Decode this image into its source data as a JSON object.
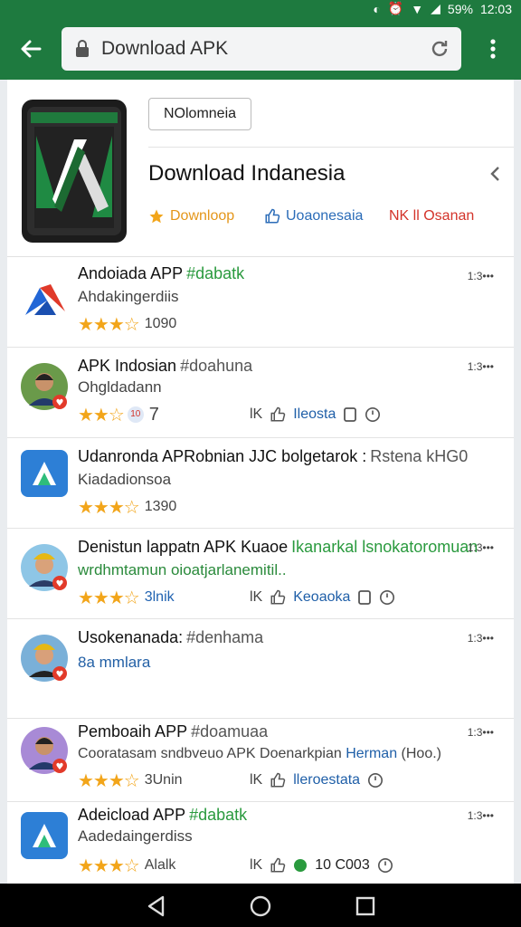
{
  "status": {
    "battery": "59%",
    "time": "12:03"
  },
  "url_bar": {
    "text": "Download APK"
  },
  "header": {
    "region_chip": "NOlomneia",
    "title": "Download Indanesia",
    "actions": {
      "download": "Downloop",
      "like": "Uoaonesaia",
      "report": "NK ll Osanan"
    }
  },
  "items": [
    {
      "title": "Andoiada APP",
      "tag": "#dabatk",
      "subtitle": "Ahdakingerdiis",
      "stars": "★★★☆",
      "count": "1090",
      "time": "1:3•••"
    },
    {
      "title": "APK Indosian",
      "tag": "#doahuna",
      "subtitle": "Ohgldadann",
      "stars": "★★☆",
      "count": "7",
      "time": "1:3•••",
      "mid_left": "lK",
      "mid_link": "Ileosta"
    },
    {
      "title": "Udanronda APRobnian ЈЈС bolgetarok :",
      "tag": "Rstena kHG0",
      "subtitle": "Kiadadionsoa",
      "stars": "★★★☆",
      "count": "1390",
      "time": ""
    },
    {
      "title": "Denistun lappatn APK Kuaoe",
      "tag": "Ikanarkal lsnokatoromuan",
      "subtitle": "wrdhmtamun oioatjarlanemitil..",
      "stars": "★★★☆",
      "count": "3lnik",
      "time": "1:3•••",
      "mid_left": "lK",
      "mid_link": "Keoaoka"
    },
    {
      "title": "Usokenanada:",
      "tag": "#denhama",
      "subtitle": "8a mmlara",
      "time": "1:3•••"
    },
    {
      "title": "Pemboaih APP",
      "tag": "#doamuaa",
      "subtitle": "Cooratasam sndbveuo APK Doenarkpian",
      "subtitle_link": "Herman",
      "subtitle_tail": "(Hoo.)",
      "stars": "★★★☆",
      "count": "3Unin",
      "time": "1:3•••",
      "mid_left": "lK",
      "mid_link": "lleroestata"
    },
    {
      "title": "Adeicload APP",
      "tag": "#dabatk",
      "subtitle": "Aadedaingerdiss",
      "stars": "★★★☆",
      "count": "Alalk",
      "time": "1:3•••",
      "mid_left": "lK",
      "mid_link": "10 C003"
    }
  ],
  "colors": {
    "brand": "#1e7a3f",
    "star": "#f2a51a",
    "link": "#1f62b1",
    "report": "#d3332a"
  }
}
